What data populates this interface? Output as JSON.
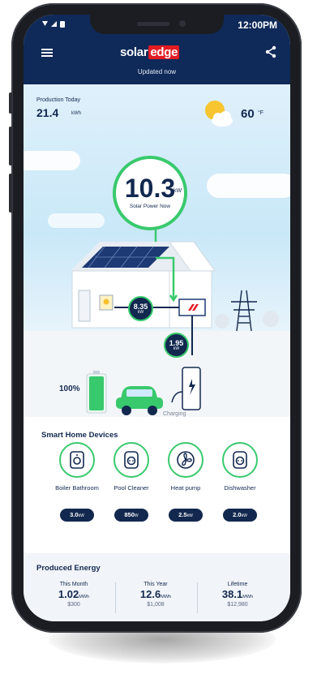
{
  "status_bar": {
    "time": "12:00PM"
  },
  "header": {
    "logo_part1": "solar",
    "logo_part2": "edge",
    "updated": "Updated now"
  },
  "production": {
    "label": "Production Today",
    "value": "21.4",
    "unit": "kWh"
  },
  "weather": {
    "temperature": "60",
    "unit": "°F",
    "icon": "partly-sunny-icon"
  },
  "power_now": {
    "value": "10.3",
    "unit": "kW",
    "label": "Solar Power Now"
  },
  "flows": {
    "home": {
      "value": "8.35",
      "unit": "kW"
    },
    "grid_to_charger": {
      "value": "1.95",
      "unit": "kW"
    }
  },
  "battery": {
    "percent": "100%",
    "level": 1.0
  },
  "ev": {
    "status": "Charging"
  },
  "smart_home": {
    "title": "Smart Home Devices",
    "devices": [
      {
        "name": "Boiler Bathroom",
        "value": "3.0",
        "unit": "kW",
        "icon": "boiler-icon"
      },
      {
        "name": "Pool Cleaner",
        "value": "850",
        "unit": "W",
        "icon": "smart-plug-icon"
      },
      {
        "name": "Heat pump",
        "value": "2.5",
        "unit": "kW",
        "icon": "fan-icon"
      },
      {
        "name": "Dishwasher",
        "value": "2.0",
        "unit": "kW",
        "icon": "smart-plug-icon"
      }
    ]
  },
  "energy": {
    "title": "Produced Energy",
    "columns": [
      {
        "label": "This Month",
        "value": "1.02",
        "unit": "MWh",
        "money": "$300"
      },
      {
        "label": "This Year",
        "value": "12.6",
        "unit": "MWh",
        "money": "$1,008"
      },
      {
        "label": "Lifetime",
        "value": "38.1",
        "unit": "MWh",
        "money": "$12,980"
      }
    ]
  },
  "colors": {
    "navy": "#0f2a59",
    "green": "#39c96d",
    "brand_red": "#e31b23"
  }
}
